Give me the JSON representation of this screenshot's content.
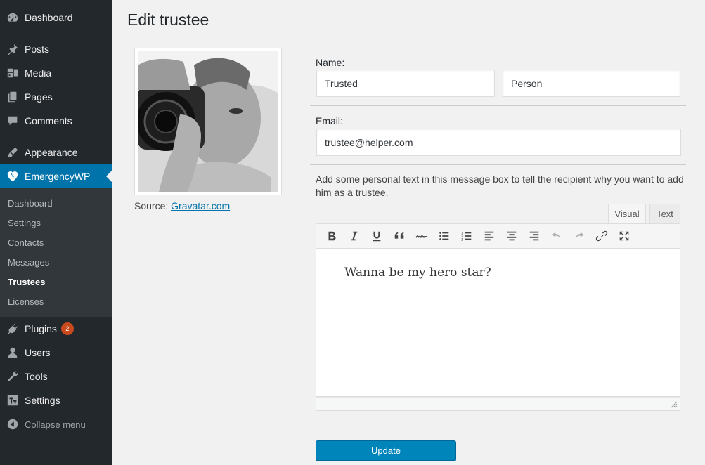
{
  "sidebar": {
    "items": [
      {
        "label": "Dashboard",
        "icon": "dashboard-icon"
      },
      {
        "label": "Posts",
        "icon": "pin-icon"
      },
      {
        "label": "Media",
        "icon": "media-icon"
      },
      {
        "label": "Pages",
        "icon": "pages-icon"
      },
      {
        "label": "Comments",
        "icon": "comment-icon"
      },
      {
        "label": "Appearance",
        "icon": "brush-icon"
      },
      {
        "label": "EmergencyWP",
        "icon": "heartbeat-icon"
      },
      {
        "label": "Plugins",
        "icon": "plugin-icon",
        "badge": "2"
      },
      {
        "label": "Users",
        "icon": "user-icon"
      },
      {
        "label": "Tools",
        "icon": "wrench-icon"
      },
      {
        "label": "Settings",
        "icon": "settings-icon"
      },
      {
        "label": "Collapse menu",
        "icon": "collapse-icon"
      }
    ],
    "submenu": [
      "Dashboard",
      "Settings",
      "Contacts",
      "Messages",
      "Trustees",
      "Licenses"
    ],
    "active_color": "#0073aa"
  },
  "page": {
    "title": "Edit trustee",
    "source_prefix": "Source:",
    "source_link": "Gravatar.com"
  },
  "form": {
    "name_label": "Name:",
    "first_name": "Trusted",
    "last_name": "Person",
    "email_label": "Email:",
    "email": "trustee@helper.com",
    "message_help": "Add some personal text in this message box to tell the recipient why you want to add him as a trustee.",
    "tab_visual": "Visual",
    "tab_text": "Text",
    "message": "Wanna be my hero star?",
    "update_label": "Update"
  }
}
